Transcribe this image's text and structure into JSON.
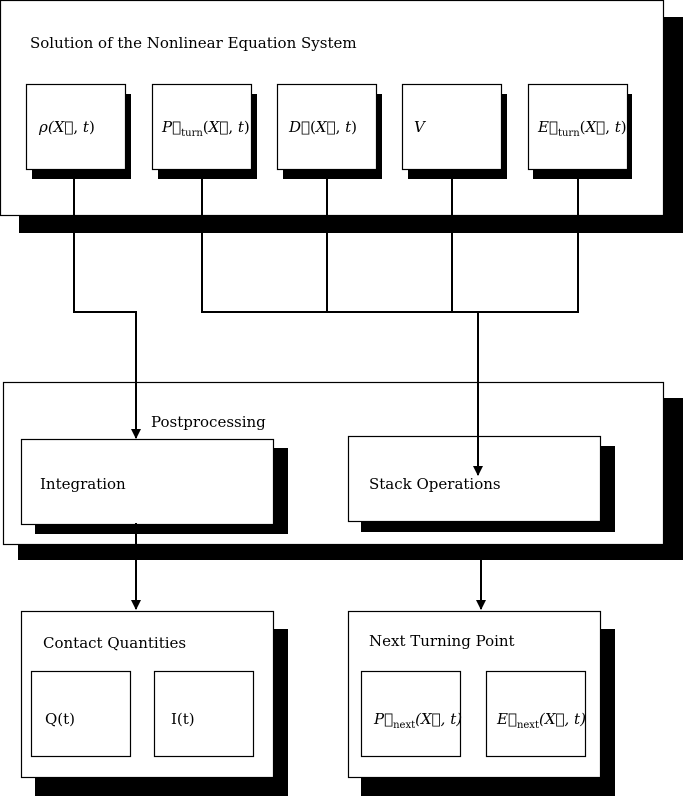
{
  "diagram": {
    "solution_group": {
      "title": "Solution of the Nonlinear Equation System",
      "variables": [
        {
          "id": "rho",
          "base": "ρ",
          "vec": false,
          "sub": "",
          "args": "(X⃗, t)"
        },
        {
          "id": "p-turn",
          "base": "P⃗",
          "vec": true,
          "sub": "turn",
          "args": "(X⃗, t)"
        },
        {
          "id": "d",
          "base": "D⃗",
          "vec": true,
          "sub": "",
          "args": "(X⃗, t)"
        },
        {
          "id": "v",
          "base": "V",
          "vec": false,
          "sub": "",
          "args": ""
        },
        {
          "id": "e-turn",
          "base": "E⃗",
          "vec": true,
          "sub": "turn",
          "args": "(X⃗, t)"
        }
      ]
    },
    "postprocessing_group": {
      "title": "Postprocessing",
      "integration": "Integration",
      "stack_operations": "Stack Operations"
    },
    "contact_group": {
      "title": "Contact Quantities",
      "items": [
        "Q(t)",
        "I(t)"
      ]
    },
    "next_turning_group": {
      "title": "Next Turning Point",
      "items": [
        {
          "base": "P⃗",
          "sub": "next",
          "args": "(X⃗, t)"
        },
        {
          "base": "E⃗",
          "sub": "next",
          "args": "(X⃗, t)"
        }
      ]
    },
    "connections": [
      {
        "from": "rho",
        "to": "Integration"
      },
      {
        "from": [
          "p-turn",
          "d",
          "v",
          "e-turn"
        ],
        "to": "Stack Operations"
      },
      {
        "from": "Integration",
        "to": "Contact Quantities"
      },
      {
        "from": "Stack Operations",
        "to": "Next Turning Point"
      }
    ]
  }
}
